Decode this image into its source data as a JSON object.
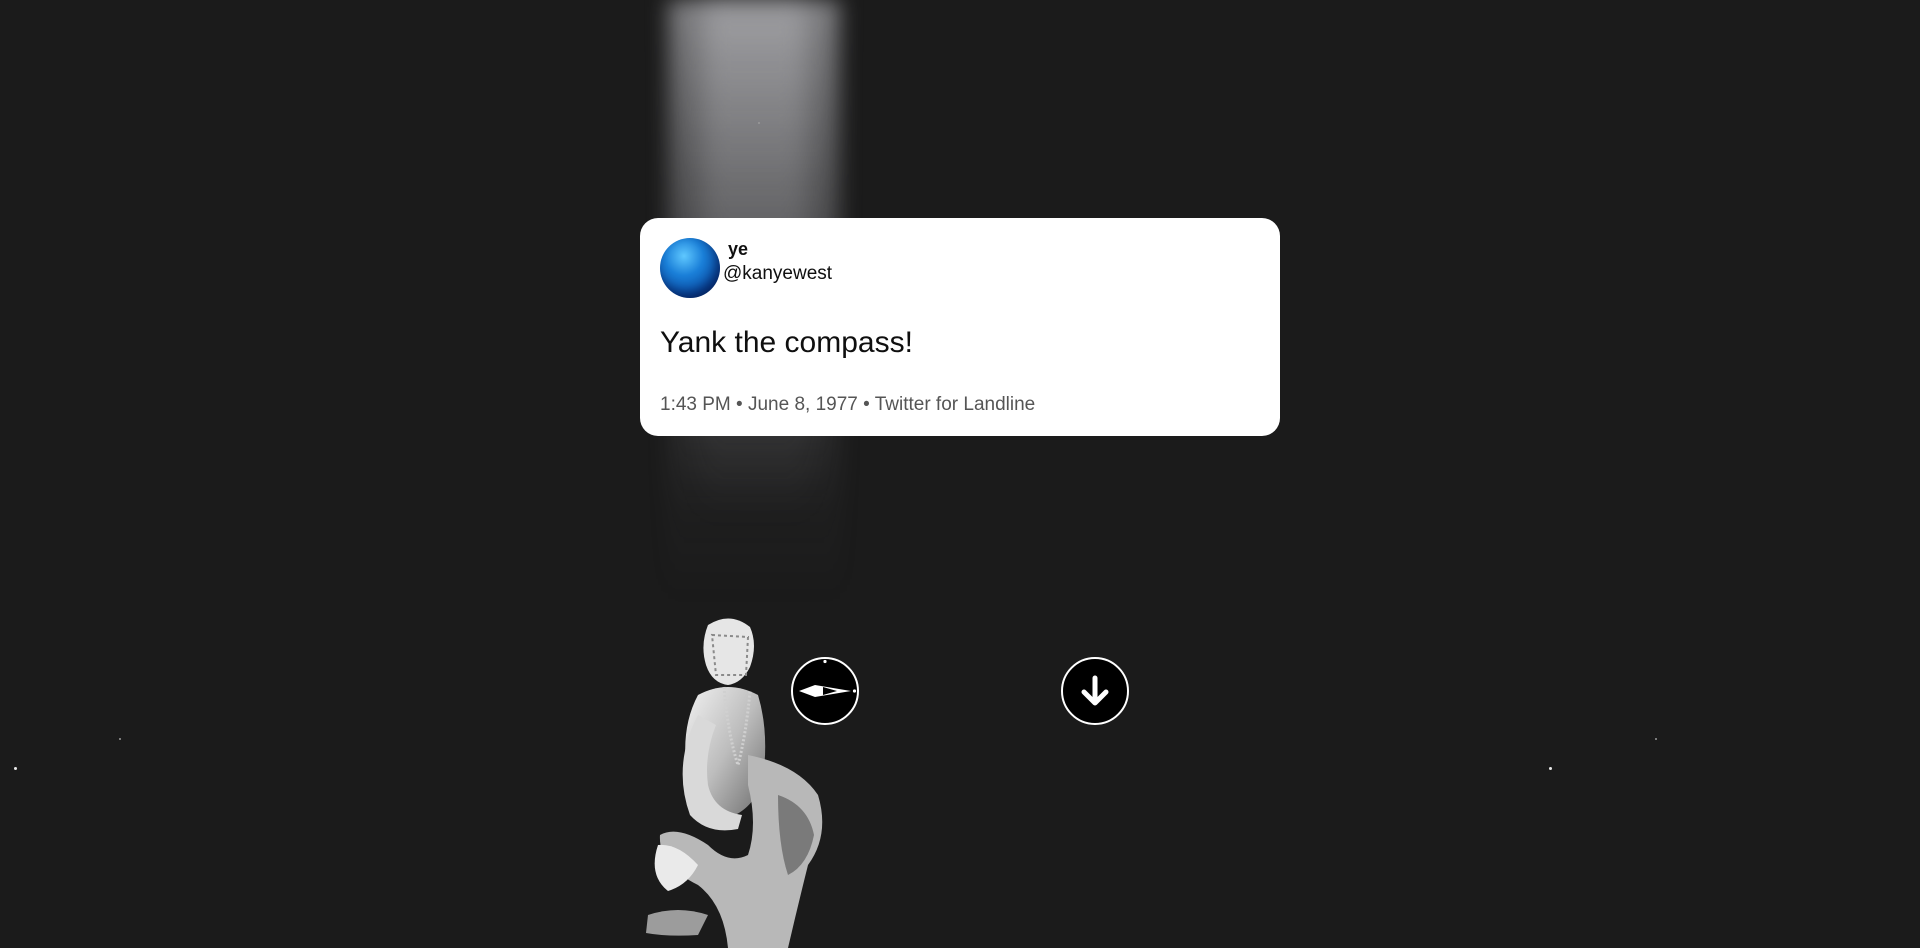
{
  "tweet": {
    "name": "ye",
    "handle": "@kanyewest",
    "text": "Yank the compass!",
    "meta": "1:43 PM • June 8, 1977 • Twitter for Landline"
  },
  "icons": {
    "avatar": "blue-sphere-avatar",
    "compass": "compass-icon",
    "down": "arrow-down-icon"
  },
  "colors": {
    "background": "#1b1b1b",
    "card": "#ffffff",
    "avatar_blue": "#1a7fd8"
  }
}
